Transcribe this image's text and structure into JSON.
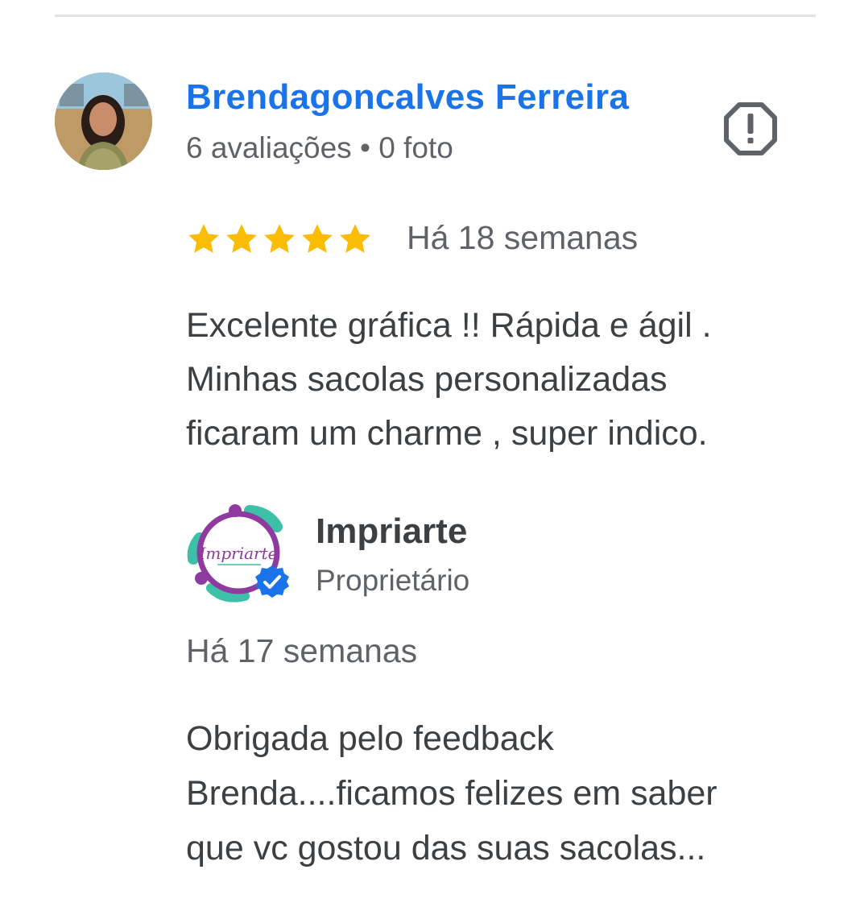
{
  "review": {
    "reviewer_name": "Brendagoncalves Ferreira",
    "reviewer_stats": "6 avaliações • 0 foto",
    "rating": 5,
    "rating_max": 5,
    "star_color": "#fbbc04",
    "time": "Há 18 semanas",
    "text_lines": [
      "Excelente gráfica !! Rápida e ágil .",
      "Minhas sacolas personalizadas",
      "ficaram um charme , super indico."
    ],
    "report_icon": "report-octagon-icon"
  },
  "owner_reply": {
    "name": "Impriarte",
    "role": "Proprietário",
    "logo_text": "Impriarte",
    "verified_icon": "verified-badge-icon",
    "time": "Há 17 semanas",
    "text_lines": [
      "Obrigada pelo feedback",
      "Brenda....ficamos felizes em saber",
      "que vc gostou das suas sacolas..."
    ]
  },
  "colors": {
    "accent": "#1a73e8",
    "text": "#3c4043",
    "secondary_text": "#5f6368",
    "logo_purple": "#8e3a9e",
    "logo_teal": "#3dbfa8"
  }
}
